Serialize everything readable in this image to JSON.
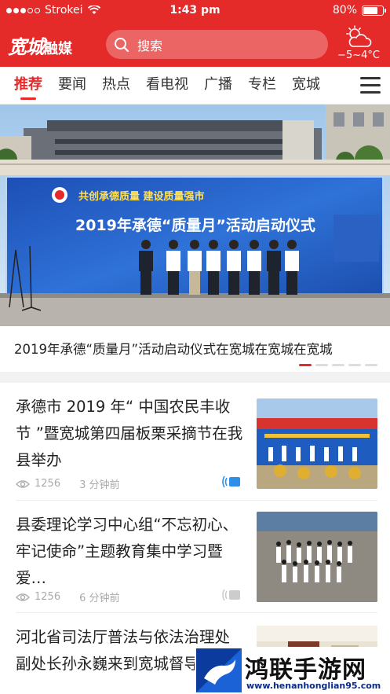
{
  "status_bar": {
    "carrier": "Strokei",
    "time": "1:43 pm",
    "battery_percent_label": "80%",
    "battery_level": 0.8,
    "signal_bars": 3
  },
  "header": {
    "logo_main": "宽城",
    "logo_sub": "融媒",
    "search_placeholder": "搜索",
    "weather_icon": "partly-cloudy-icon",
    "temperature": "−5~4°C",
    "accent_color": "#e52a2a"
  },
  "tabs": [
    {
      "label": "推荐",
      "active": true
    },
    {
      "label": "要闻",
      "active": false
    },
    {
      "label": "热点",
      "active": false
    },
    {
      "label": "看电视",
      "active": false
    },
    {
      "label": "广播",
      "active": false
    },
    {
      "label": "专栏",
      "active": false
    },
    {
      "label": "宽城",
      "active": false
    }
  ],
  "banner": {
    "caption": "2019年承德“质量月”活动启动仪式在宽城在宽城在宽城",
    "stage_slogan": "共创承德质量  建设质量强市",
    "stage_title": "2019年承德“质量月”活动启动仪式",
    "pages": 5,
    "current_page": 1
  },
  "news": [
    {
      "title": "承德市 2019 年“ 中国农民丰收节 ”暨宽城第四届板栗采摘节在我县举办",
      "views": "1256",
      "time": "3 分钟前",
      "audio_active": true
    },
    {
      "title": "县委理论学习中心组“不忘初心、牢记使命”主题教育集中学习暨爱…",
      "views": "1256",
      "time": "6 分钟前",
      "audio_active": false
    },
    {
      "title": "河北省司法厅普法与依法治理处副处长孙永巍来到宽城督导“全…",
      "views": "",
      "time": "",
      "audio_active": false
    }
  ],
  "watermark": {
    "name": "鸿联手游网",
    "url": "www.henanhonglian95.com"
  }
}
